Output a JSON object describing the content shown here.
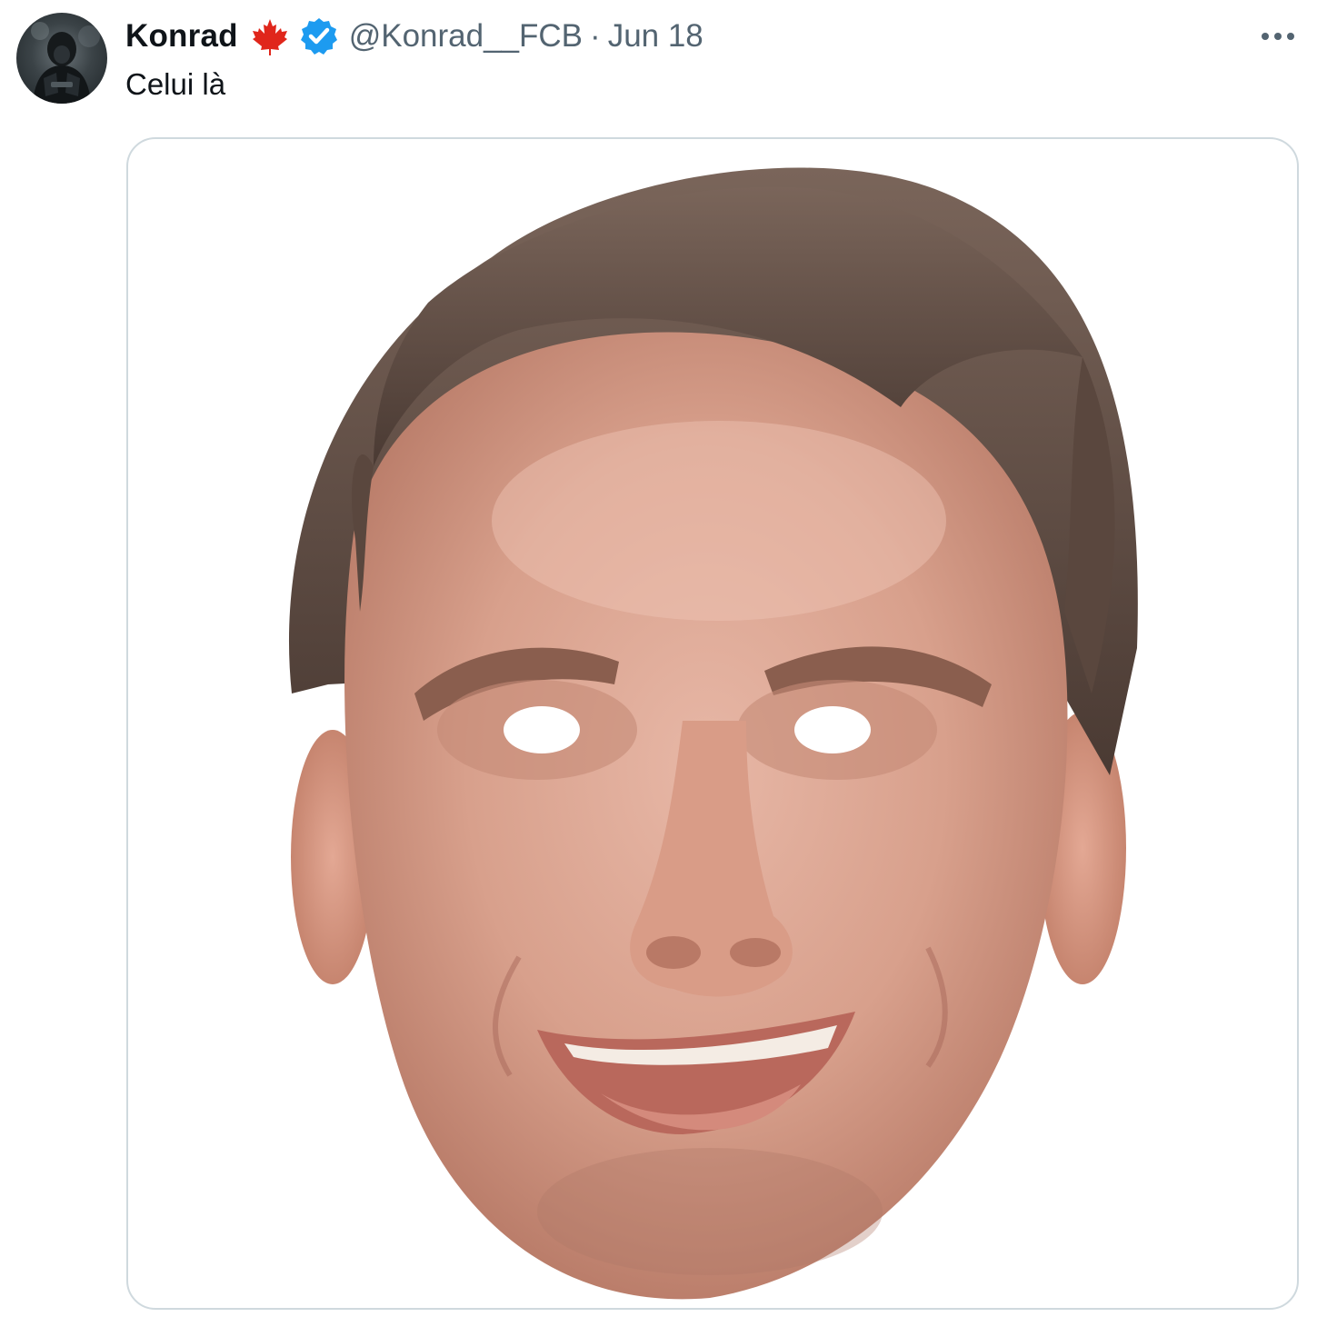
{
  "tweet": {
    "display_name": "Konrad",
    "handle": "@Konrad__FCB",
    "separator": "·",
    "timestamp": "Jun 18",
    "text": "Celui là",
    "flag_icon": "maple-leaf-icon",
    "verified_icon": "verified-badge-icon",
    "more_icon": "more-horizontal-icon",
    "accent_color": "#1d9bf0",
    "flag_color": "#e0261b"
  },
  "media": {
    "type": "image",
    "subject": "printed face mask with eye holes"
  }
}
